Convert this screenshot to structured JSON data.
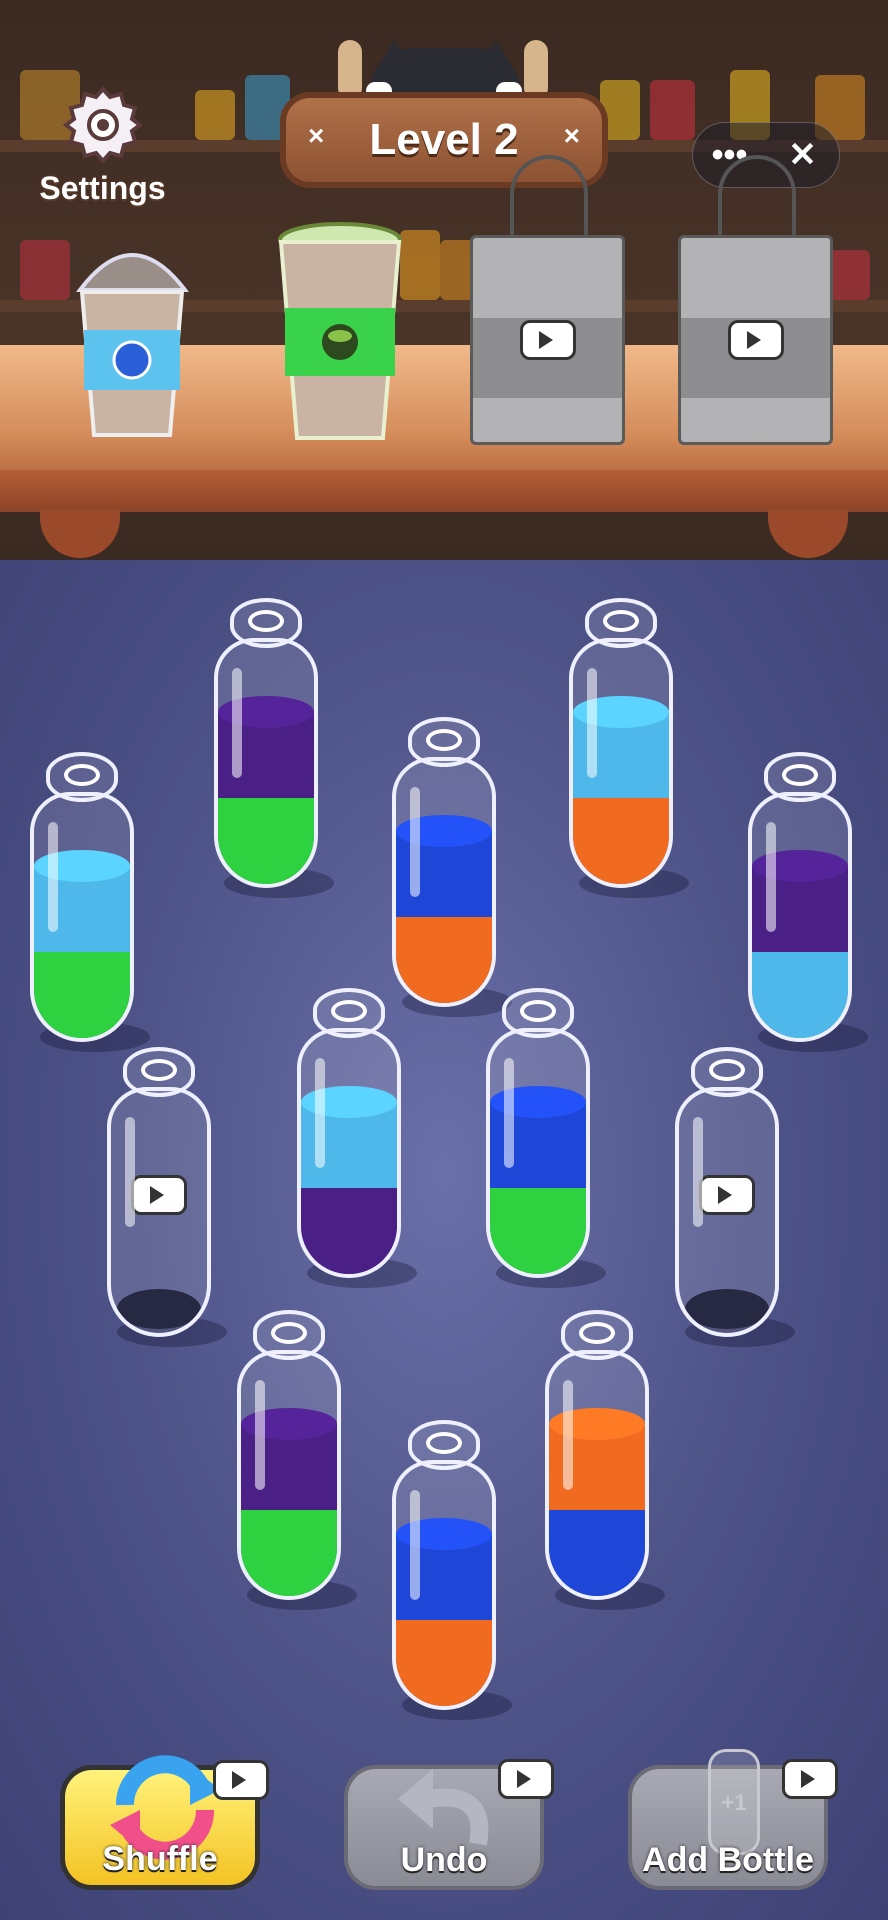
{
  "header": {
    "settings_label": "Settings",
    "level_title": "Level 2"
  },
  "topbar": {
    "more_symbol": "•••",
    "close_symbol": "✕"
  },
  "orders": [
    {
      "type": "cup",
      "flavor": "blueberry",
      "color": "#5cc3ef"
    },
    {
      "type": "cup",
      "flavor": "matcha",
      "color": "#3ad24a"
    },
    {
      "type": "bag",
      "locked": true,
      "icon": "video-icon"
    },
    {
      "type": "bag",
      "locked": true,
      "icon": "video-icon"
    }
  ],
  "colors": {
    "purple": "#4a1f86",
    "green": "#2ed13f",
    "lightblue": "#4fb8ea",
    "orange": "#f06a1f",
    "blue": "#1e47d8"
  },
  "bottles": [
    {
      "layers": [
        "green",
        "purple"
      ]
    },
    {
      "layers": [
        "orange",
        "lightblue"
      ]
    },
    {
      "layers": [
        "green",
        "lightblue"
      ]
    },
    {
      "layers": [
        "orange",
        "blue"
      ]
    },
    {
      "layers": [
        "lightblue",
        "purple"
      ]
    },
    {
      "layers": [
        "purple",
        "lightblue"
      ]
    },
    {
      "layers": [
        "green",
        "blue"
      ]
    },
    {
      "layers": [],
      "locked": true
    },
    {
      "layers": [],
      "locked": true
    },
    {
      "layers": [
        "green",
        "purple"
      ]
    },
    {
      "layers": [
        "blue",
        "orange"
      ]
    },
    {
      "layers": [
        "orange",
        "blue"
      ]
    }
  ],
  "buttons": {
    "shuffle_label": "Shuffle",
    "undo_label": "Undo",
    "add_bottle_label": "Add Bottle",
    "add_bottle_badge": "+1"
  }
}
